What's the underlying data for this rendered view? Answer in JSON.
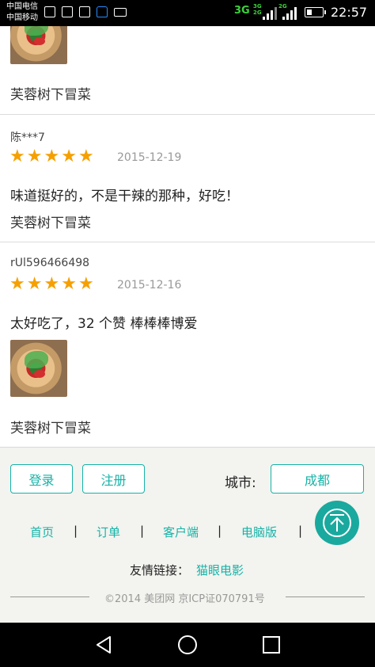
{
  "status_bar": {
    "carrier_1": "中国电信",
    "carrier_2": "中国移动",
    "network_1": "3G",
    "network_2_top": "3G",
    "network_2_bottom": "2G",
    "network_3": "2G",
    "time": "22:57"
  },
  "reviews": [
    {
      "shop": "芙蓉树下冒菜",
      "has_photo": true
    },
    {
      "user": "陈***7",
      "rating": 5,
      "date": "2015-12-19",
      "comment": "味道挺好的，不是干辣的那种，好吃！",
      "shop": "芙蓉树下冒菜"
    },
    {
      "user": "rUl596466498",
      "rating": 5,
      "date": "2015-12-16",
      "comment": "太好吃了，32 个赞 棒棒棒博爱",
      "shop": "芙蓉树下冒菜",
      "has_photo": true
    }
  ],
  "footer": {
    "login_label": "登录",
    "register_label": "注册",
    "city_label": "城市:",
    "city_value": "成都",
    "links": [
      "首页",
      "订单",
      "客户端",
      "电脑版"
    ],
    "separator": "|",
    "friend_links_label": "友情链接：",
    "friend_link": "猫眼电影",
    "copyright": "©2014 美团网 京ICP证070791号"
  },
  "colors": {
    "accent": "#16b3a8",
    "star": "#f5a000"
  },
  "icons": [
    "back-to-top-icon",
    "nav-back-icon",
    "nav-home-icon",
    "nav-recents-icon"
  ]
}
